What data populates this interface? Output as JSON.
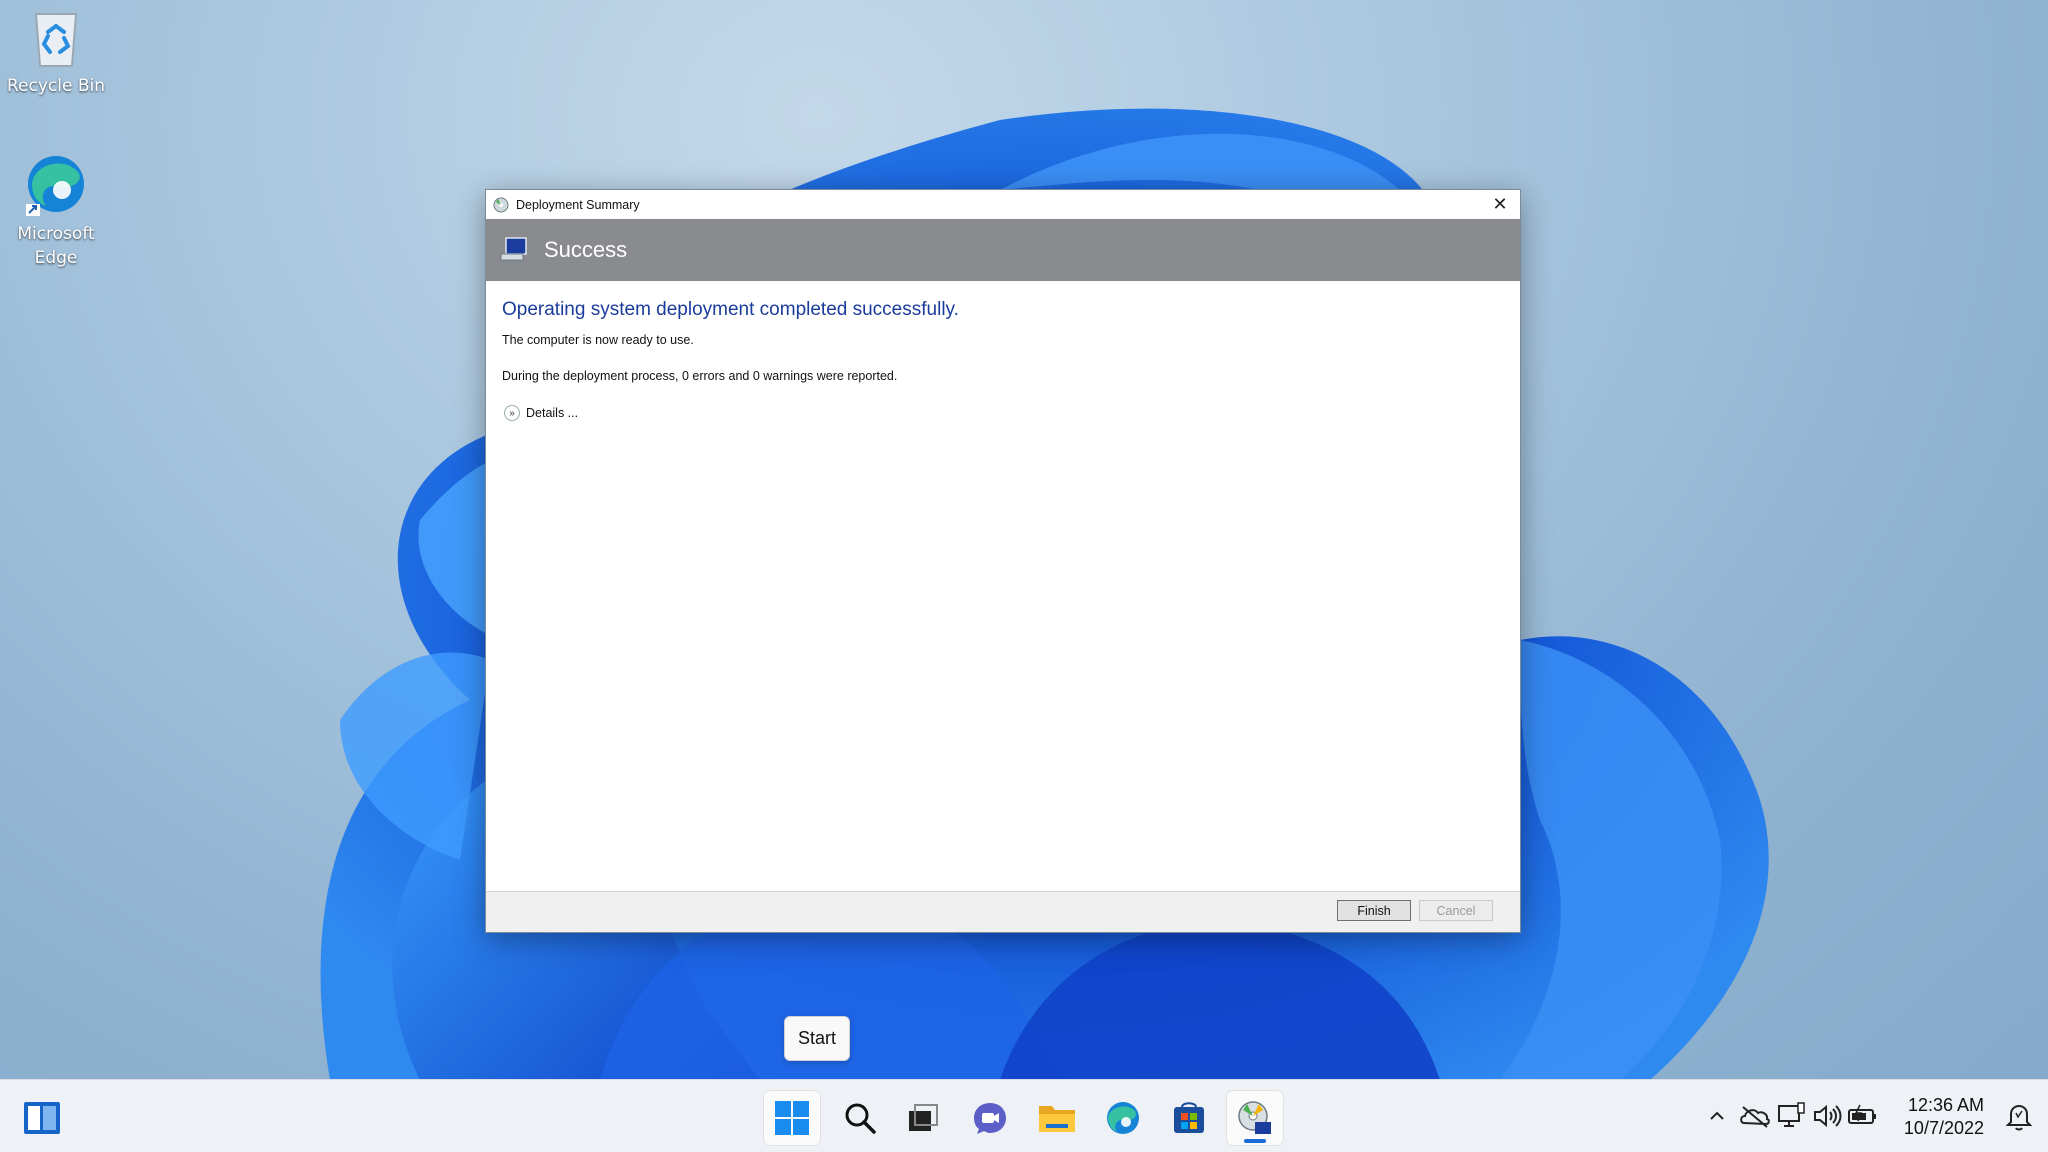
{
  "desktop": {
    "icons": [
      {
        "label": "Recycle Bin"
      },
      {
        "label": "Microsoft Edge"
      }
    ]
  },
  "dialog": {
    "title": "Deployment Summary",
    "banner_title": "Success",
    "headline": "Operating system deployment completed successfully.",
    "line1": "The computer is now ready to use.",
    "line2": "During the deployment process, 0 errors and 0 warnings were reported.",
    "details_label": "Details ...",
    "finish_label": "Finish",
    "cancel_label": "Cancel",
    "close_glyph": "✕"
  },
  "tooltip": {
    "text": "Start"
  },
  "taskbar": {
    "items": [
      "widgets-icon",
      "start-icon",
      "search-icon",
      "task-view-icon",
      "teams-chat-icon",
      "file-explorer-icon",
      "edge-icon",
      "store-icon",
      "deployment-app-icon"
    ],
    "tray_icons": [
      "chevron-up-icon",
      "onedrive-icon",
      "network-icon",
      "volume-icon",
      "battery-icon",
      "notification-icon"
    ],
    "time": "12:36 AM",
    "date": "10/7/2022"
  },
  "colors": {
    "accent": "#1c6cd6",
    "headline": "#1a3c9c",
    "banner": "#898b8e"
  }
}
